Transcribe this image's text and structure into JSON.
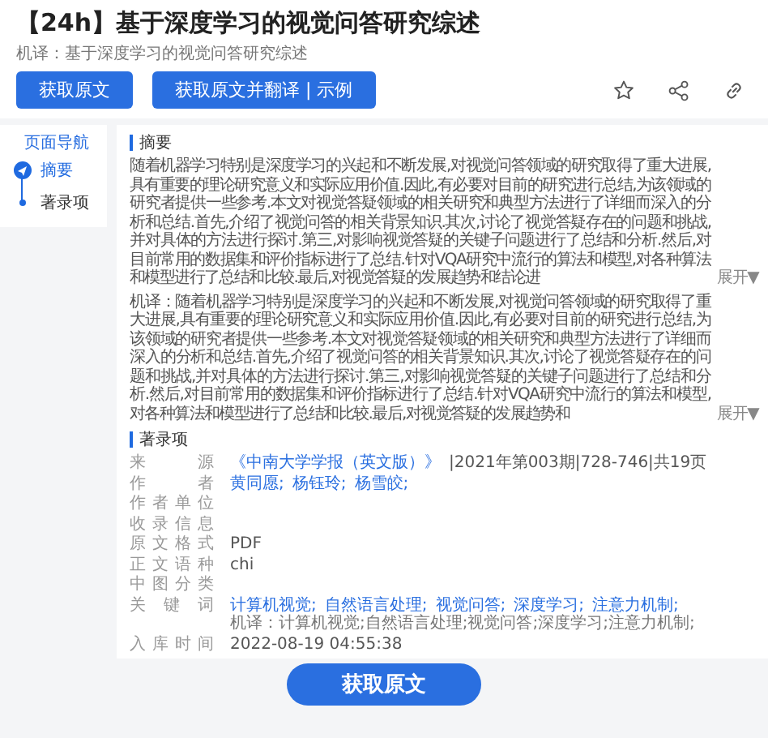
{
  "title": "【24h】基于深度学习的视觉问答研究综述",
  "subtitle": "机译：基于深度学习的视觉问答研究综述",
  "buttons": [
    {
      "label": "获取原文"
    },
    {
      "label": "获取原文并翻译 | 示例"
    }
  ],
  "nav": {
    "title": "页面导航",
    "items": [
      {
        "label": "摘要",
        "selected": true
      },
      {
        "label": "著录项",
        "selected": false
      }
    ]
  },
  "abstract": {
    "heading": "摘要",
    "paragraphs": [
      {
        "text": "随着机器学习特别是深度学习的兴起和不断发展,对视觉问答领域的研究取得了重大进展,具有重要的理论研究意义和实际应用价值.因此,有必要对目前的研究进行总结,为该领域的研究者提供一些参考.本文对视觉答疑领域的相关研究和典型方法进行了详细而深入的分析和总结.首先,介绍了视觉问答的相关背景知识.其次,讨论了视觉答疑存在的问题和挑战,并对具体的方法进行探讨.第三,对影响视觉答疑的关键子问题进行了总结和分析.然后,对目前常用的数据集和评价指标进行了总结.针对VQA研究中流行的算法和模型,对各种算法和模型进行了总结和比较.最后,对视觉答疑的发展趋势和结论进",
        "more": "展开▼"
      },
      {
        "text": "机译：随着机器学习特别是深度学习的兴起和不断发展,对视觉问答领域的研究取得了重大进展,具有重要的理论研究意义和实际应用价值.因此,有必要对目前的研究进行总结,为该领域的研究者提供一些参考.本文对视觉答疑领域的相关研究和典型方法进行了详细而深入的分析和总结.首先,介绍了视觉问答的相关背景知识.其次,讨论了视觉答疑存在的问题和挑战,并对具体的方法进行探讨.第三,对影响视觉答疑的关键子问题进行了总结和分析.然后,对目前常用的数据集和评价指标进行了总结.针对VQA研究中流行的算法和模型,对各种算法和模型进行了总结和比较.最后,对视觉答疑的发展趋势和",
        "more": "展开▼"
      }
    ]
  },
  "record": {
    "heading": "著录项",
    "rows": [
      {
        "label": "来源",
        "links": [
          "《中南大学学报（英文版）》"
        ],
        "value": "|2021年第003期|728-746|共19页"
      },
      {
        "label": "作者",
        "links": [
          "黄同愿;",
          "杨钰玲;",
          "杨雪皎;"
        ]
      },
      {
        "label": "作者单位"
      },
      {
        "label": "收录信息"
      },
      {
        "label": "原文格式",
        "value": "PDF"
      },
      {
        "label": "正文语种",
        "value": "chi"
      },
      {
        "label": "中图分类"
      },
      {
        "label": "关键词",
        "links": [
          "计算机视觉;",
          "自然语言处理;",
          "视觉问答;",
          "深度学习;",
          "注意力机制;"
        ],
        "note": "机译：计算机视觉;自然语言处理;视觉问答;深度学习;注意力机制;"
      },
      {
        "label": "入库时间",
        "value": "2022-08-19 04:55:38"
      }
    ]
  },
  "bottom_button": "获取原文"
}
